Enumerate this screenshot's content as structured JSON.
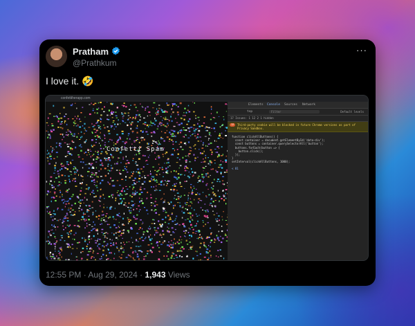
{
  "tweet": {
    "author_name": "Pratham",
    "author_handle": "@Prathkum",
    "text": "I love it. 🤣",
    "time": "12:55 PM",
    "separator": " · ",
    "date": "Aug 29, 2024",
    "views_count": "1,943",
    "views_label": "Views",
    "more_icon": "···"
  },
  "media": {
    "url": "confettiherapp.com",
    "page_title": "Confetti Spam",
    "devtools": {
      "tabs": [
        "Elements",
        "Console",
        "Sources",
        "Network"
      ],
      "active_tab": "Console",
      "context": "top",
      "filter_placeholder": "Filter",
      "levels": "Default levels",
      "issues": "17 Issues: 1  12  2",
      "hidden": "1 hidden",
      "warning_badge": "12",
      "warning": "Third-party cookie will be blocked in future Chrome versions as part of Privacy Sandbox.",
      "code": [
        "function clickAllButtons() {",
        "  const container = document.getElementById('data-div');",
        "  const buttons = container.querySelectorAll('button');",
        "  buttons.forEach(button => {",
        "    button.click();",
        "  });",
        "}",
        "",
        "setInterval(clickAllButtons, 1000);"
      ],
      "result": "< 81"
    }
  },
  "colors": {
    "card_bg": "#000000",
    "name": "#e7e9ea",
    "secondary": "#71767b",
    "verified": "#1d9bf0"
  }
}
